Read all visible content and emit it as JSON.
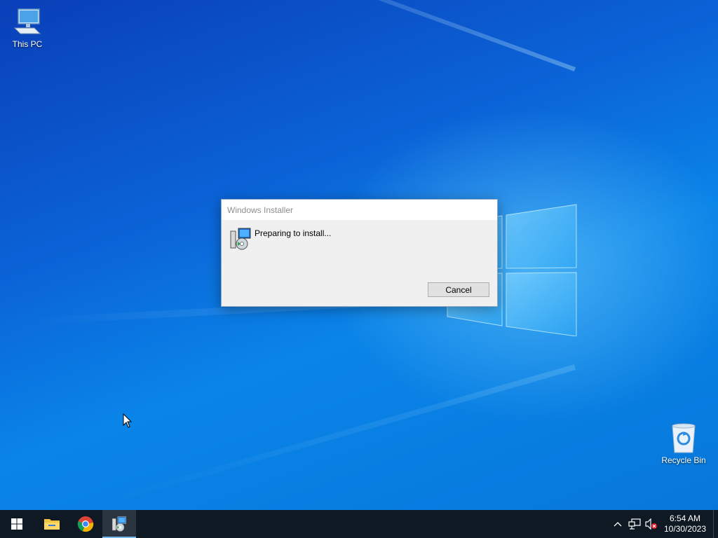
{
  "desktop": {
    "icons": [
      {
        "label": "This PC",
        "icon": "computer-icon"
      },
      {
        "label": "Recycle Bin",
        "icon": "recycle-bin-icon"
      }
    ]
  },
  "dialog": {
    "title": "Windows Installer",
    "message": "Preparing to install...",
    "icon": "installer-icon",
    "cancel_label": "Cancel"
  },
  "taskbar": {
    "start": {
      "icon": "windows-start-icon"
    },
    "pinned": [
      {
        "name": "File Explorer",
        "icon": "folder-icon"
      },
      {
        "name": "Google Chrome",
        "icon": "chrome-icon"
      },
      {
        "name": "Windows Installer",
        "icon": "installer-icon",
        "active": true
      }
    ],
    "tray": {
      "icons": [
        "chevron-up-icon",
        "network-icon",
        "volume-muted-icon"
      ],
      "time": "6:54 AM",
      "date": "10/30/2023"
    }
  },
  "colors": {
    "taskbar_bg": "#0f1923",
    "active_indicator": "#76b9ed",
    "dialog_bg": "#f0f0f0",
    "desktop_blue": "#0a84e8"
  }
}
